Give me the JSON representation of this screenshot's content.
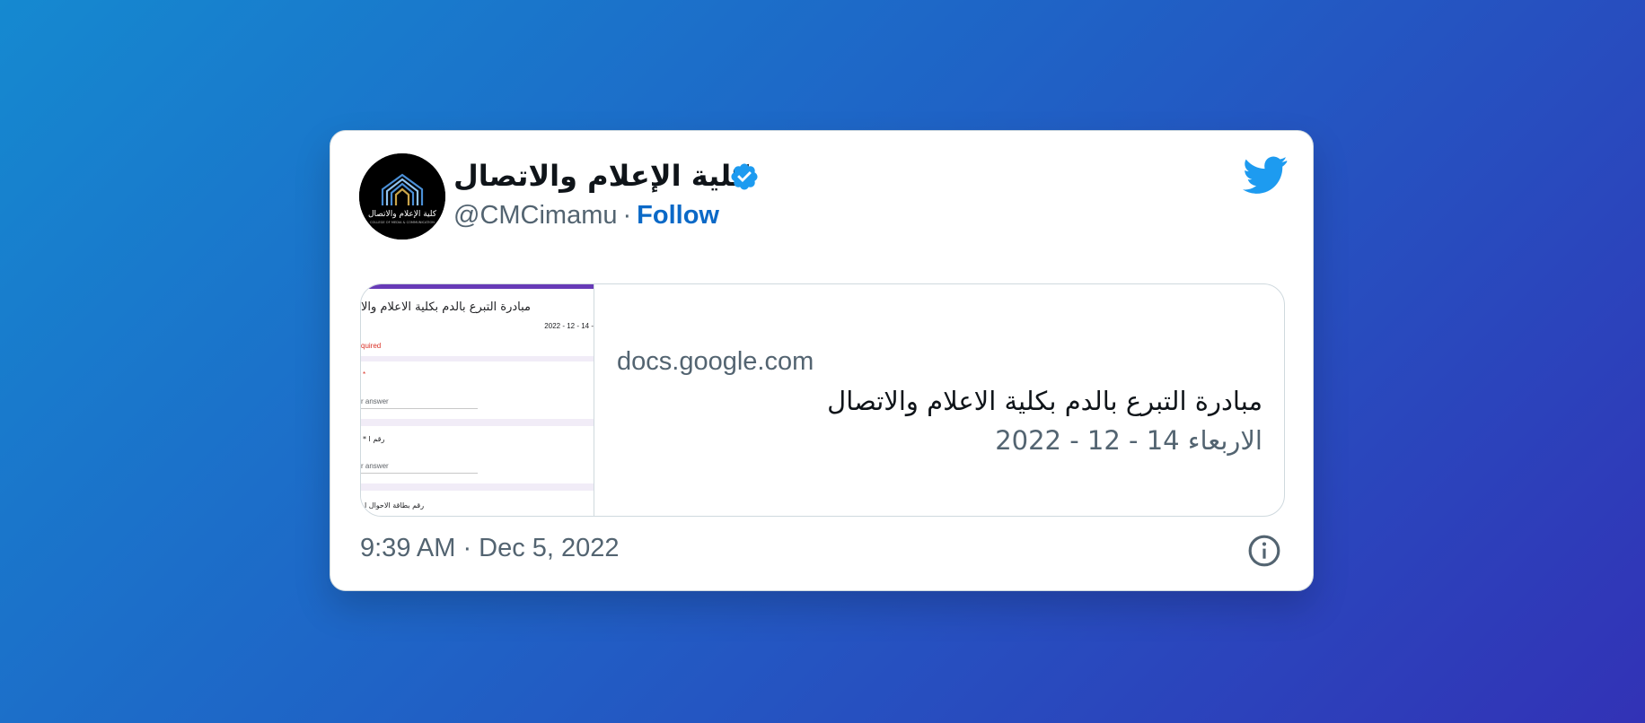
{
  "tweet": {
    "author": {
      "display_name": "كلية الإعلام والاتصال",
      "handle": "@CMCimamu",
      "separator": "·",
      "follow_label": "Follow",
      "avatar_logo_text": "كلية الإعلام والاتصال",
      "avatar_logo_subtext": "COLLEGE OF MEDIA & COMMUNICATION"
    },
    "link_card": {
      "domain": "docs.google.com",
      "title": "مبادرة التبرع بالدم بكلية الاعلام والاتصال",
      "description": "الاربعاء 14 - 12 - 2022",
      "thumbnail": {
        "form_title": "مبادرة التبرع بالدم بكلية الاعلام والاتصا",
        "form_date": "2022 - 12 - 14 -",
        "required_text": "quired",
        "q1_marker": "*",
        "answer_placeholder": "r answer",
        "q2_label": "* رقم ا",
        "answer_placeholder_2": "r answer",
        "q3_label": "رقم بطاقة الاحوال ا"
      }
    },
    "timestamp": "9:39 AM · Dec 5, 2022"
  },
  "colors": {
    "background_start": "#1589d0",
    "background_end": "#3232b6",
    "twitter_blue": "#1d9bf0",
    "follow_blue": "#0b69c7",
    "secondary_text": "#536471",
    "primary_text": "#0f1419",
    "form_accent": "#673ab7"
  },
  "icons": {
    "verified": "verified-badge-icon",
    "twitter": "twitter-bird-icon",
    "info": "info-icon"
  }
}
